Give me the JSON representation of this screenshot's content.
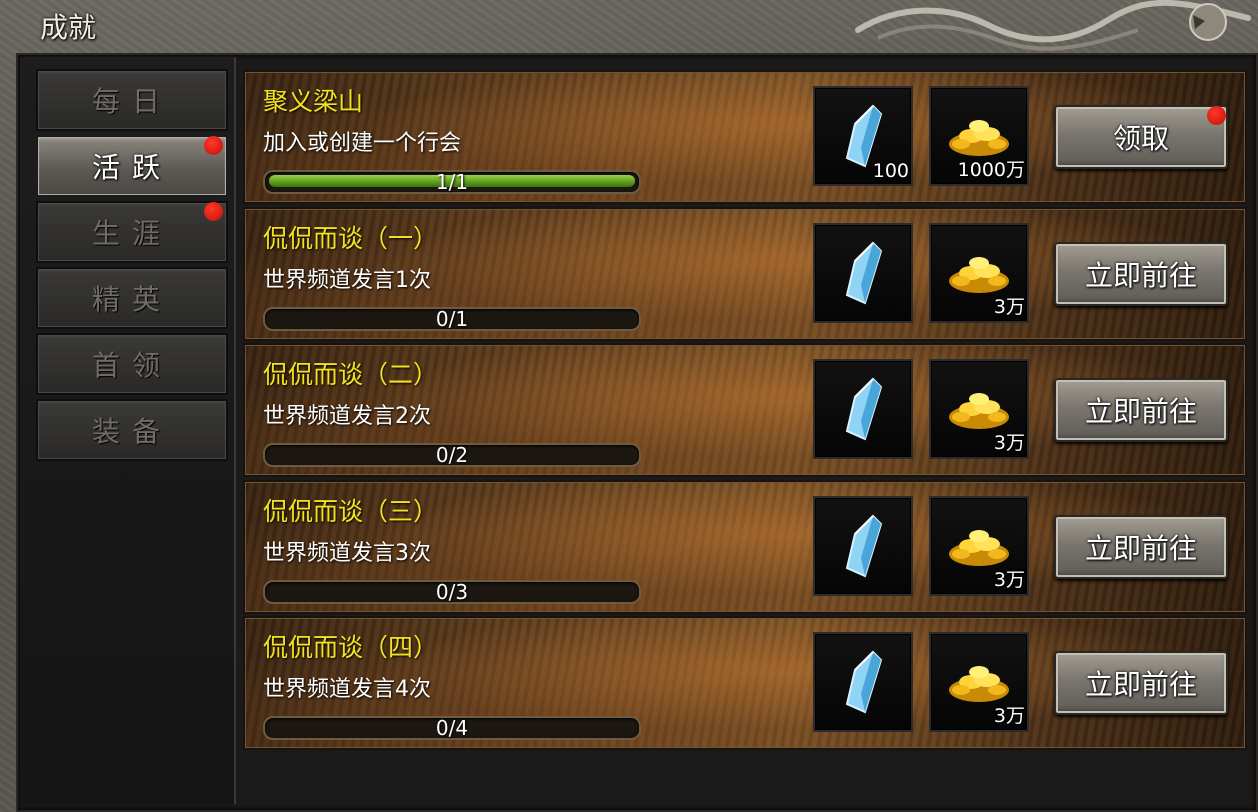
{
  "window": {
    "title": "成就"
  },
  "sidebar": {
    "items": [
      {
        "label": "每日",
        "active": false,
        "badge": false
      },
      {
        "label": "活跃",
        "active": true,
        "badge": true
      },
      {
        "label": "生涯",
        "active": false,
        "badge": true
      },
      {
        "label": "精英",
        "active": false,
        "badge": false
      },
      {
        "label": "首领",
        "active": false,
        "badge": false
      },
      {
        "label": "装备",
        "active": false,
        "badge": false
      }
    ]
  },
  "achievements": [
    {
      "title": "聚义梁山",
      "desc": "加入或创建一个行会",
      "progress_text": "1/1",
      "progress_fraction": 1.0,
      "rewards": [
        {
          "icon": "crystal-icon",
          "count": "100"
        },
        {
          "icon": "gold-icon",
          "count": "1000万"
        }
      ],
      "action_label": "领取",
      "badge": true
    },
    {
      "title": "侃侃而谈（一）",
      "desc": "世界频道发言1次",
      "progress_text": "0/1",
      "progress_fraction": 0,
      "rewards": [
        {
          "icon": "crystal-icon",
          "count": ""
        },
        {
          "icon": "gold-icon",
          "count": "3万"
        }
      ],
      "action_label": "立即前往",
      "badge": false
    },
    {
      "title": "侃侃而谈（二）",
      "desc": "世界频道发言2次",
      "progress_text": "0/2",
      "progress_fraction": 0,
      "rewards": [
        {
          "icon": "crystal-icon",
          "count": ""
        },
        {
          "icon": "gold-icon",
          "count": "3万"
        }
      ],
      "action_label": "立即前往",
      "badge": false
    },
    {
      "title": "侃侃而谈（三）",
      "desc": "世界频道发言3次",
      "progress_text": "0/3",
      "progress_fraction": 0,
      "rewards": [
        {
          "icon": "crystal-icon",
          "count": ""
        },
        {
          "icon": "gold-icon",
          "count": "3万"
        }
      ],
      "action_label": "立即前往",
      "badge": false
    },
    {
      "title": "侃侃而谈（四）",
      "desc": "世界频道发言4次",
      "progress_text": "0/4",
      "progress_fraction": 0,
      "rewards": [
        {
          "icon": "crystal-icon",
          "count": ""
        },
        {
          "icon": "gold-icon",
          "count": "3万"
        }
      ],
      "action_label": "立即前往",
      "badge": false
    }
  ],
  "colors": {
    "title_yellow": "#f4e21e",
    "badge_red": "#e01408",
    "progress_green": "#6fb22a"
  }
}
